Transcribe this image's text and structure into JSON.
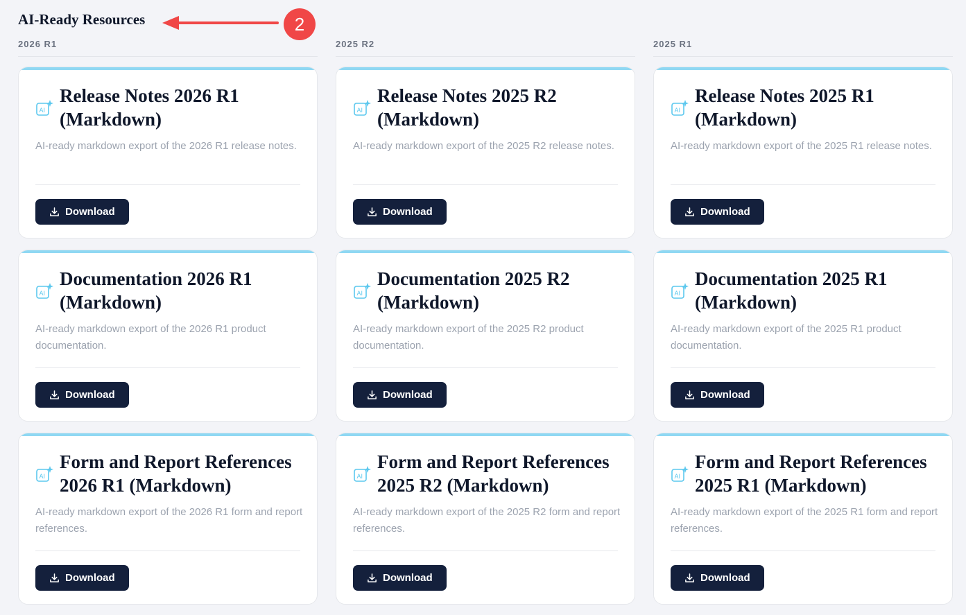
{
  "section_title": "AI-Ready Resources",
  "annotation_badge": "2",
  "colors": {
    "accent": "#8fd8f3",
    "button": "#14203c",
    "annotation": "#f04747"
  },
  "columns": [
    {
      "header": "2026 R1",
      "cards": [
        {
          "title": "Release Notes 2026 R1 (Markdown)",
          "description": "AI-ready markdown export of the 2026 R1 release notes.",
          "button": "Download"
        },
        {
          "title": "Documentation 2026 R1 (Markdown)",
          "description": "AI-ready markdown export of the 2026 R1 product documentation.",
          "button": "Download"
        },
        {
          "title": "Form and Report References 2026 R1 (Markdown)",
          "description": "AI-ready markdown export of the 2026 R1 form and report references.",
          "button": "Download"
        }
      ]
    },
    {
      "header": "2025 R2",
      "cards": [
        {
          "title": "Release Notes 2025 R2 (Markdown)",
          "description": "AI-ready markdown export of the 2025 R2 release notes.",
          "button": "Download"
        },
        {
          "title": "Documentation 2025 R2 (Markdown)",
          "description": "AI-ready markdown export of the 2025 R2 product documentation.",
          "button": "Download"
        },
        {
          "title": "Form and Report References 2025 R2 (Markdown)",
          "description": "AI-ready markdown export of the 2025 R2 form and report references.",
          "button": "Download"
        }
      ]
    },
    {
      "header": "2025 R1",
      "cards": [
        {
          "title": "Release Notes 2025 R1 (Markdown)",
          "description": "AI-ready markdown export of the 2025 R1 release notes.",
          "button": "Download"
        },
        {
          "title": "Documentation 2025 R1 (Markdown)",
          "description": "AI-ready markdown export of the 2025 R1 product documentation.",
          "button": "Download"
        },
        {
          "title": "Form and Report References 2025 R1 (Markdown)",
          "description": "AI-ready markdown export of the 2025 R1 form and report references.",
          "button": "Download"
        }
      ]
    }
  ]
}
